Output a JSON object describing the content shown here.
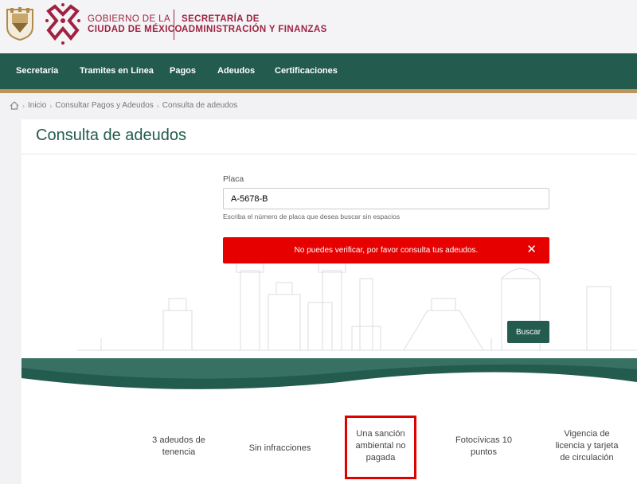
{
  "header": {
    "gob_line1": "GOBIERNO DE LA",
    "gob_line2": "CIUDAD DE MÉXICO",
    "sec_line1": "SECRETARÍA DE",
    "sec_line2": "ADMINISTRACIÓN Y FINANZAS"
  },
  "nav": {
    "items": [
      "Secretaría",
      "Tramites en Línea",
      "Pagos",
      "Adeudos",
      "Certificaciones"
    ]
  },
  "breadcrumb": {
    "items": [
      "Inicio",
      "Consultar Pagos y Adeudos",
      "Consulta de adeudos"
    ]
  },
  "main": {
    "title": "Consulta de adeudos",
    "placa_label": "Placa",
    "placa_value": "A-5678-B",
    "placa_help": "Escriba el número de placa que desea buscar sin espacios",
    "alert_text": "No puedes verificar, por favor consulta tus adeudos.",
    "alert_close": "✕",
    "buscar_label": "Buscar"
  },
  "stats": {
    "tenencia": [
      "3 adeudos de",
      "tenencia"
    ],
    "infracciones": "Sin infracciones",
    "sancion": [
      "Una sanción",
      "ambiental no",
      "pagada"
    ],
    "fotocivicas": [
      "Fotocívicas 10",
      "puntos"
    ],
    "vigencia": [
      "Vigencia de",
      "licencia y tarjeta",
      "de circulación"
    ]
  },
  "colors": {
    "brand_green": "#235b4e",
    "brand_wine": "#9f2241",
    "brand_gold": "#bc955c",
    "alert_red": "#e60000"
  }
}
